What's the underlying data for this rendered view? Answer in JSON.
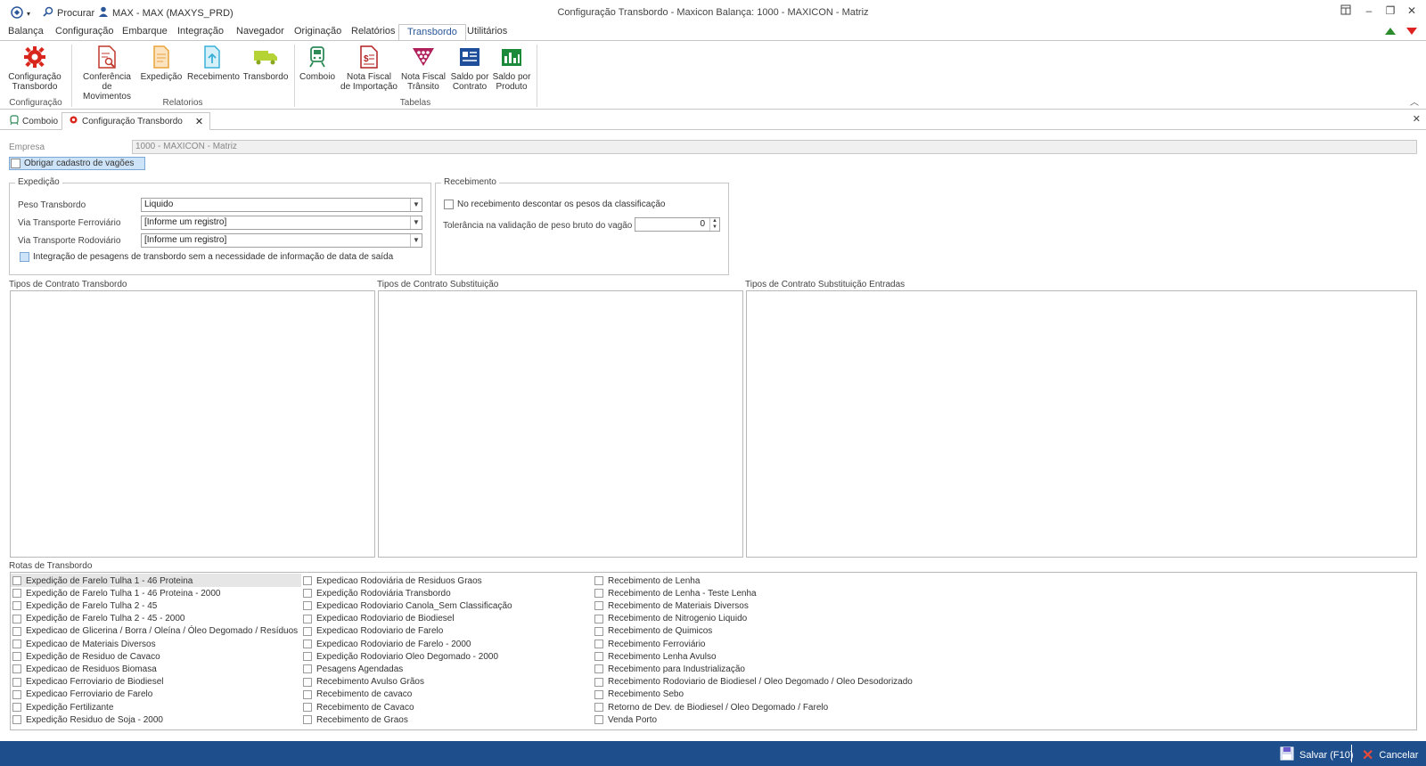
{
  "titlebar": {
    "search_label": "Procurar",
    "user_label": "MAX - MAX (MAXYS_PRD)",
    "window_title": "Configuração Transbordo - Maxicon Balança: 1000 - MAXICON - Matriz"
  },
  "menu": {
    "tabs": [
      "Balança",
      "Configuração",
      "Embarque",
      "Integração",
      "Navegador",
      "Originação",
      "Relatórios",
      "Transbordo",
      "Utilitários"
    ],
    "active": "Transbordo"
  },
  "ribbon": {
    "buttons": {
      "config_transbordo": "Configuração\nTransbordo",
      "conferencia": "Conferência\nde Movimentos",
      "expedicao": "Expedição",
      "recebimento": "Recebimento",
      "transbordo": "Transbordo",
      "comboio": "Comboio",
      "nf_importacao": "Nota Fiscal\nde Importação",
      "nf_transito": "Nota Fiscal\nTrânsito",
      "saldo_contrato": "Saldo por\nContrato",
      "saldo_produto": "Saldo por\nProduto"
    },
    "groups": {
      "configuracao": "Configuração",
      "relatorios": "Relatorios",
      "tabelas": "Tabelas"
    }
  },
  "doc_tabs": {
    "tab1": "Comboio",
    "tab2": "Configuração Transbordo"
  },
  "form": {
    "empresa_label": "Empresa",
    "empresa_value": "1000 - MAXICON - Matriz",
    "obrigar_label": "Obrigar cadastro de vagões",
    "expedicao": {
      "title": "Expedição",
      "peso_label": "Peso Transbordo",
      "peso_value": "Liquido",
      "ferro_label": "Via Transporte Ferroviário",
      "ferro_value": "[Informe um registro]",
      "rodo_label": "Via Transporte Rodoviário",
      "rodo_value": "[Informe um registro]",
      "integracao_label": "Integração de pesagens de transbordo sem a necessidade de informação de data de saída"
    },
    "recebimento": {
      "title": "Recebimento",
      "descontar_label": "No recebimento descontar os pesos da classificação",
      "tolerancia_label": "Tolerância na validação de peso bruto do vagão (%)",
      "tolerancia_value": "0"
    },
    "tipos_transbordo_label": "Tipos de Contrato Transbordo",
    "tipos_substituicao_label": "Tipos de Contrato Substituição",
    "tipos_subst_entradas_label": "Tipos de Contrato Substituição Entradas",
    "rotas_label": "Rotas de Transbordo"
  },
  "rotas": {
    "col1": [
      "Expedição de Farelo Tulha 1 - 46 Proteina",
      "Expedição de Farelo Tulha 1 - 46 Proteina - 2000",
      "Expedição de Farelo Tulha 2 - 45",
      "Expedição de Farelo Tulha 2 - 45 - 2000",
      "Expedicao de Glicerina / Borra / Oleína / Óleo Degomado / Resíduos",
      "Expedicao de Materiais Diversos",
      "Expedição de Residuo de Cavaco",
      "Expedicao de Residuos Biomasa",
      "Expedicao Ferroviario de Biodiesel",
      "Expedicao Ferroviario de Farelo",
      "Expedição Fertilizante",
      "Expedição Residuo de Soja - 2000"
    ],
    "col2": [
      "Expedicao Rodoviária de Residuos Graos",
      "Expedição Rodoviária Transbordo",
      "Expedicao Rodoviario Canola_Sem Classificação",
      "Expedicao Rodoviario de Biodiesel",
      "Expedicao Rodoviario de Farelo",
      "Expedicao Rodoviario de Farelo - 2000",
      "Expedição Rodoviario Oleo Degomado - 2000",
      "Pesagens Agendadas",
      "Recebimento Avulso Grãos",
      "Recebimento de cavaco",
      "Recebimento de Cavaco",
      "Recebimento de Graos"
    ],
    "col3": [
      "Recebimento de Lenha",
      "Recebimento de Lenha - Teste Lenha",
      "Recebimento de Materiais Diversos",
      "Recebimento de Nitrogenio Liquido",
      "Recebimento de Quimicos",
      "Recebimento Ferroviário",
      "Recebimento Lenha Avulso",
      "Recebimento para Industrialização",
      "Recebimento Rodoviario de Biodiesel / Oleo Degomado / Oleo Desodorizado",
      "Recebimento Sebo",
      "Retorno de Dev. de Biodiesel / Oleo Degomado / Farelo",
      "Venda Porto"
    ]
  },
  "status": {
    "save_label": "Salvar (F10)",
    "cancel_label": "Cancelar"
  },
  "colors": {
    "status_bar": "#1e4e8c",
    "active_tab_text": "#2b579a",
    "highlight": "#cde3f7"
  }
}
